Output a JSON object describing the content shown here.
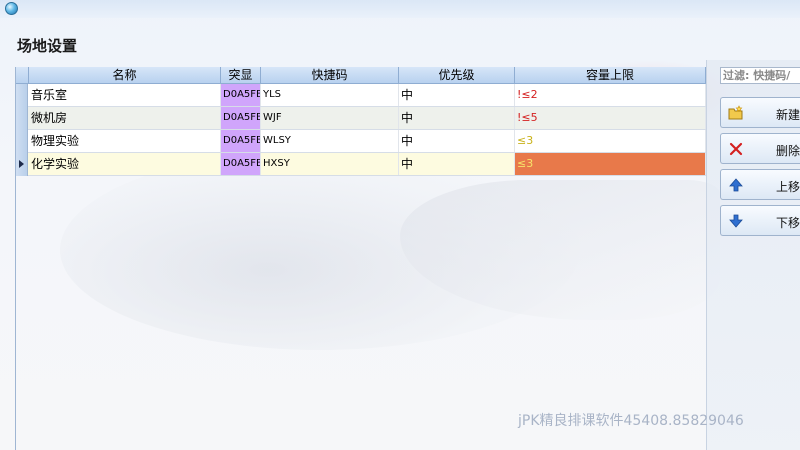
{
  "page_title": "场地设置",
  "grid": {
    "columns": {
      "name": "名称",
      "highlight": "突显",
      "shortcut": "快捷码",
      "priority": "优先级",
      "capacity": "容量上限"
    },
    "rows": [
      {
        "name": "音乐室",
        "highlight": "D0A5FB",
        "shortcut": "YLS",
        "priority": "中",
        "capacity": "!≤2"
      },
      {
        "name": "微机房",
        "highlight": "D0A5FB",
        "shortcut": "WJF",
        "priority": "中",
        "capacity": "!≤5"
      },
      {
        "name": "物理实验",
        "highlight": "D0A5FB",
        "shortcut": "WLSY",
        "priority": "中",
        "capacity": "≤3"
      },
      {
        "name": "化学实验",
        "highlight": "D0A5FB",
        "shortcut": "HXSY",
        "priority": "中",
        "capacity": "≤3"
      }
    ],
    "selected_row": 3,
    "highlight_color": "#d0a5fb",
    "capacity_selected_color": "#e8794a"
  },
  "side": {
    "filter_label": "过滤: 快捷码/",
    "buttons": {
      "new": "新建",
      "delete": "删除",
      "up": "上移",
      "down": "下移"
    },
    "icons": [
      "folder-new-icon",
      "delete-x-icon",
      "arrow-up-icon",
      "arrow-down-icon"
    ]
  },
  "watermark": "jPK精良排课软件45408.85829046"
}
